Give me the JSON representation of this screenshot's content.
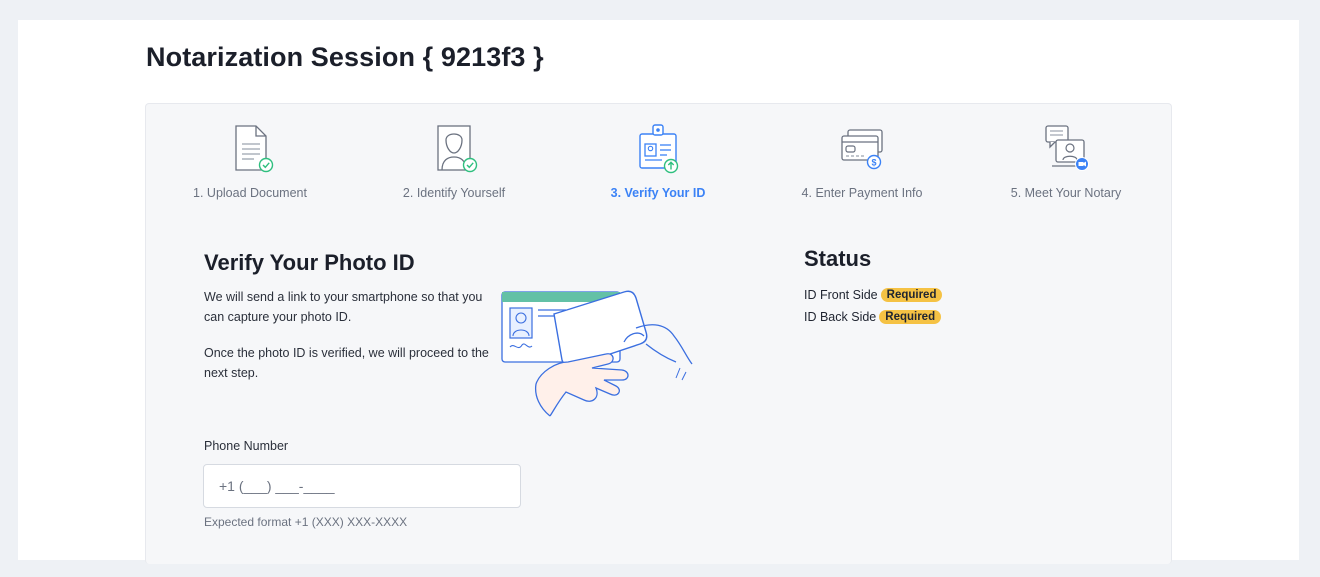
{
  "page": {
    "title": "Notarization Session { 9213f3 }"
  },
  "steps": [
    {
      "label": "1. Upload Document",
      "icon": "document-check-icon",
      "state": "complete"
    },
    {
      "label": "2. Identify Yourself",
      "icon": "portrait-check-icon",
      "state": "complete"
    },
    {
      "label": "3. Verify Your ID",
      "icon": "id-badge-upload-icon",
      "state": "active"
    },
    {
      "label": "4. Enter Payment Info",
      "icon": "credit-card-dollar-icon",
      "state": "pending"
    },
    {
      "label": "5. Meet Your Notary",
      "icon": "notary-video-icon",
      "state": "pending"
    }
  ],
  "verify": {
    "title": "Verify Your Photo ID",
    "paragraph1": "We will send a link to your smartphone so that you can capture your photo ID.",
    "paragraph2": "Once the photo ID is verified, we will proceed to the next step."
  },
  "status": {
    "title": "Status",
    "items": [
      {
        "label": "ID Front Side",
        "badge": "Required"
      },
      {
        "label": "ID Back Side",
        "badge": "Required"
      }
    ]
  },
  "phone": {
    "label": "Phone Number",
    "placeholder": "+1 (___) ___-____",
    "value": "",
    "help": "Expected format +1 (XXX) XXX-XXXX"
  },
  "colors": {
    "accent": "#3b82f6",
    "complete_check": "#2fbf7f",
    "badge_required": "#f5c244",
    "panel_background": "#f6f7f9"
  }
}
